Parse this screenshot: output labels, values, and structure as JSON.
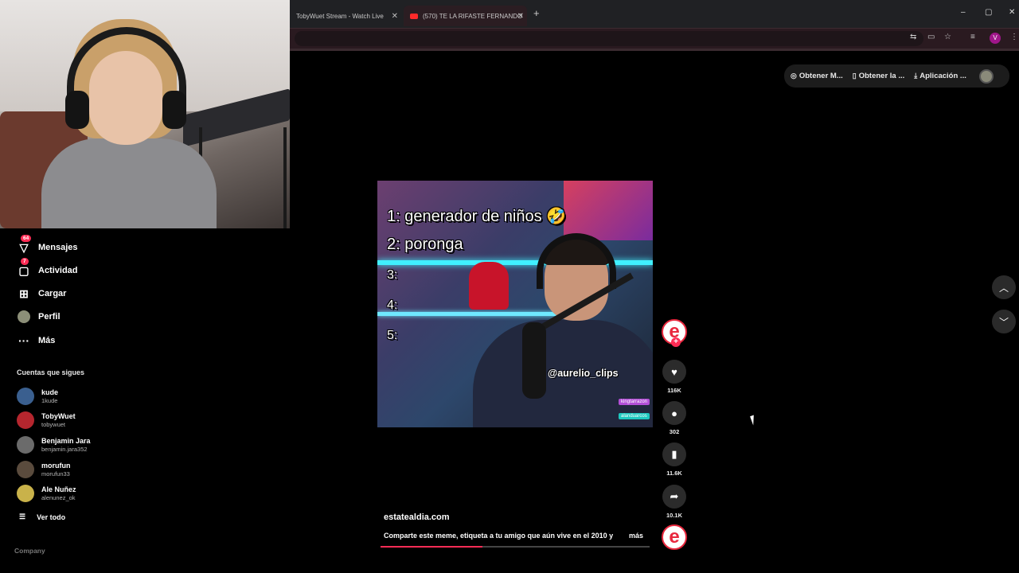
{
  "browser": {
    "tabs": [
      {
        "title": "TobyWuet Stream - Watch Live"
      },
      {
        "title": "(570) TE LA RIFASTE FERNANDO"
      }
    ],
    "new_tab": "+",
    "window_controls": {
      "minimize": "–",
      "restore": "▢",
      "close": "✕"
    },
    "profile_initial": "V"
  },
  "extension_bar": {
    "items": [
      {
        "label": "Obtener M...",
        "icon": "coin-icon"
      },
      {
        "label": "Obtener la ...",
        "icon": "phone-icon"
      },
      {
        "label": "Aplicación ...",
        "icon": "download-icon"
      }
    ]
  },
  "nav": {
    "items": [
      {
        "label": "Mensajes",
        "badge": "64",
        "icon": "messages-icon"
      },
      {
        "label": "Actividad",
        "badge": "7",
        "icon": "activity-icon"
      },
      {
        "label": "Cargar",
        "icon": "upload-icon"
      },
      {
        "label": "Perfil",
        "icon": "profile-icon"
      },
      {
        "label": "Más",
        "icon": "more-icon"
      }
    ]
  },
  "following": {
    "title": "Cuentas que sigues",
    "accounts": [
      {
        "name": "kude",
        "handle": "1kude",
        "color": "#3a5f8f"
      },
      {
        "name": "TobyWuet",
        "handle": "tobywuet",
        "color": "#b5262e"
      },
      {
        "name": "Benjamin Jara",
        "handle": "benjamin.jara352",
        "color": "#6b6b6b"
      },
      {
        "name": "morufun",
        "handle": "morufun33",
        "color": "#5a4b3d"
      },
      {
        "name": "Ale Nuñez",
        "handle": "alenunez_ok",
        "color": "#c9b24a"
      }
    ],
    "see_all": "Ver todo"
  },
  "company_label": "Company",
  "video": {
    "lines": [
      "1: generador de niños 🤣",
      "2: poronga",
      "3:",
      "4:",
      "5:"
    ],
    "overlay_handle": "@aurelio_clips",
    "chat_pills": [
      "kingtarrazon",
      "alanduarcos"
    ]
  },
  "actions": {
    "likes": "116K",
    "comments": "302",
    "saves": "11.6K",
    "shares": "10.1K",
    "creator_logo": "e"
  },
  "post": {
    "author": "estatealdia.com",
    "caption": "Comparte este meme, etiqueta a tu amigo que aún vive en el 2010 y",
    "more": "más",
    "progress": 0.38
  },
  "colors": {
    "accent": "#fe2c55",
    "creator_red": "#e8283e"
  }
}
